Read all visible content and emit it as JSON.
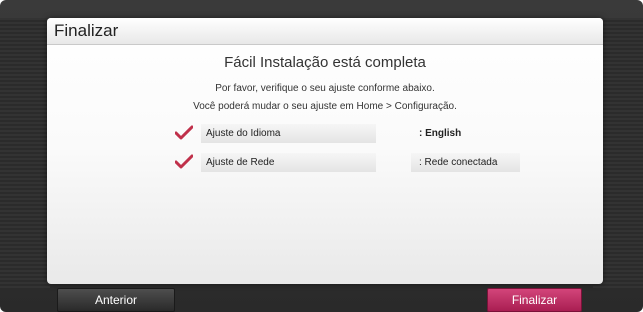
{
  "window": {
    "title": "Finalizar"
  },
  "content": {
    "heading": "Fácil Instalação está completa",
    "line1": "Por favor, verifique o seu ajuste conforme abaixo.",
    "line2": "Você poderá mudar o seu ajuste em Home > Configuração."
  },
  "settings": [
    {
      "label": "Ajuste do Idioma",
      "value": ": English",
      "checked": true
    },
    {
      "label": "Ajuste de Rede",
      "value": ": Rede conectada",
      "checked": true
    }
  ],
  "buttons": {
    "previous": "Anterior",
    "finish": "Finalizar"
  },
  "colors": {
    "accent": "#c0305f",
    "check": "#c0304a"
  }
}
